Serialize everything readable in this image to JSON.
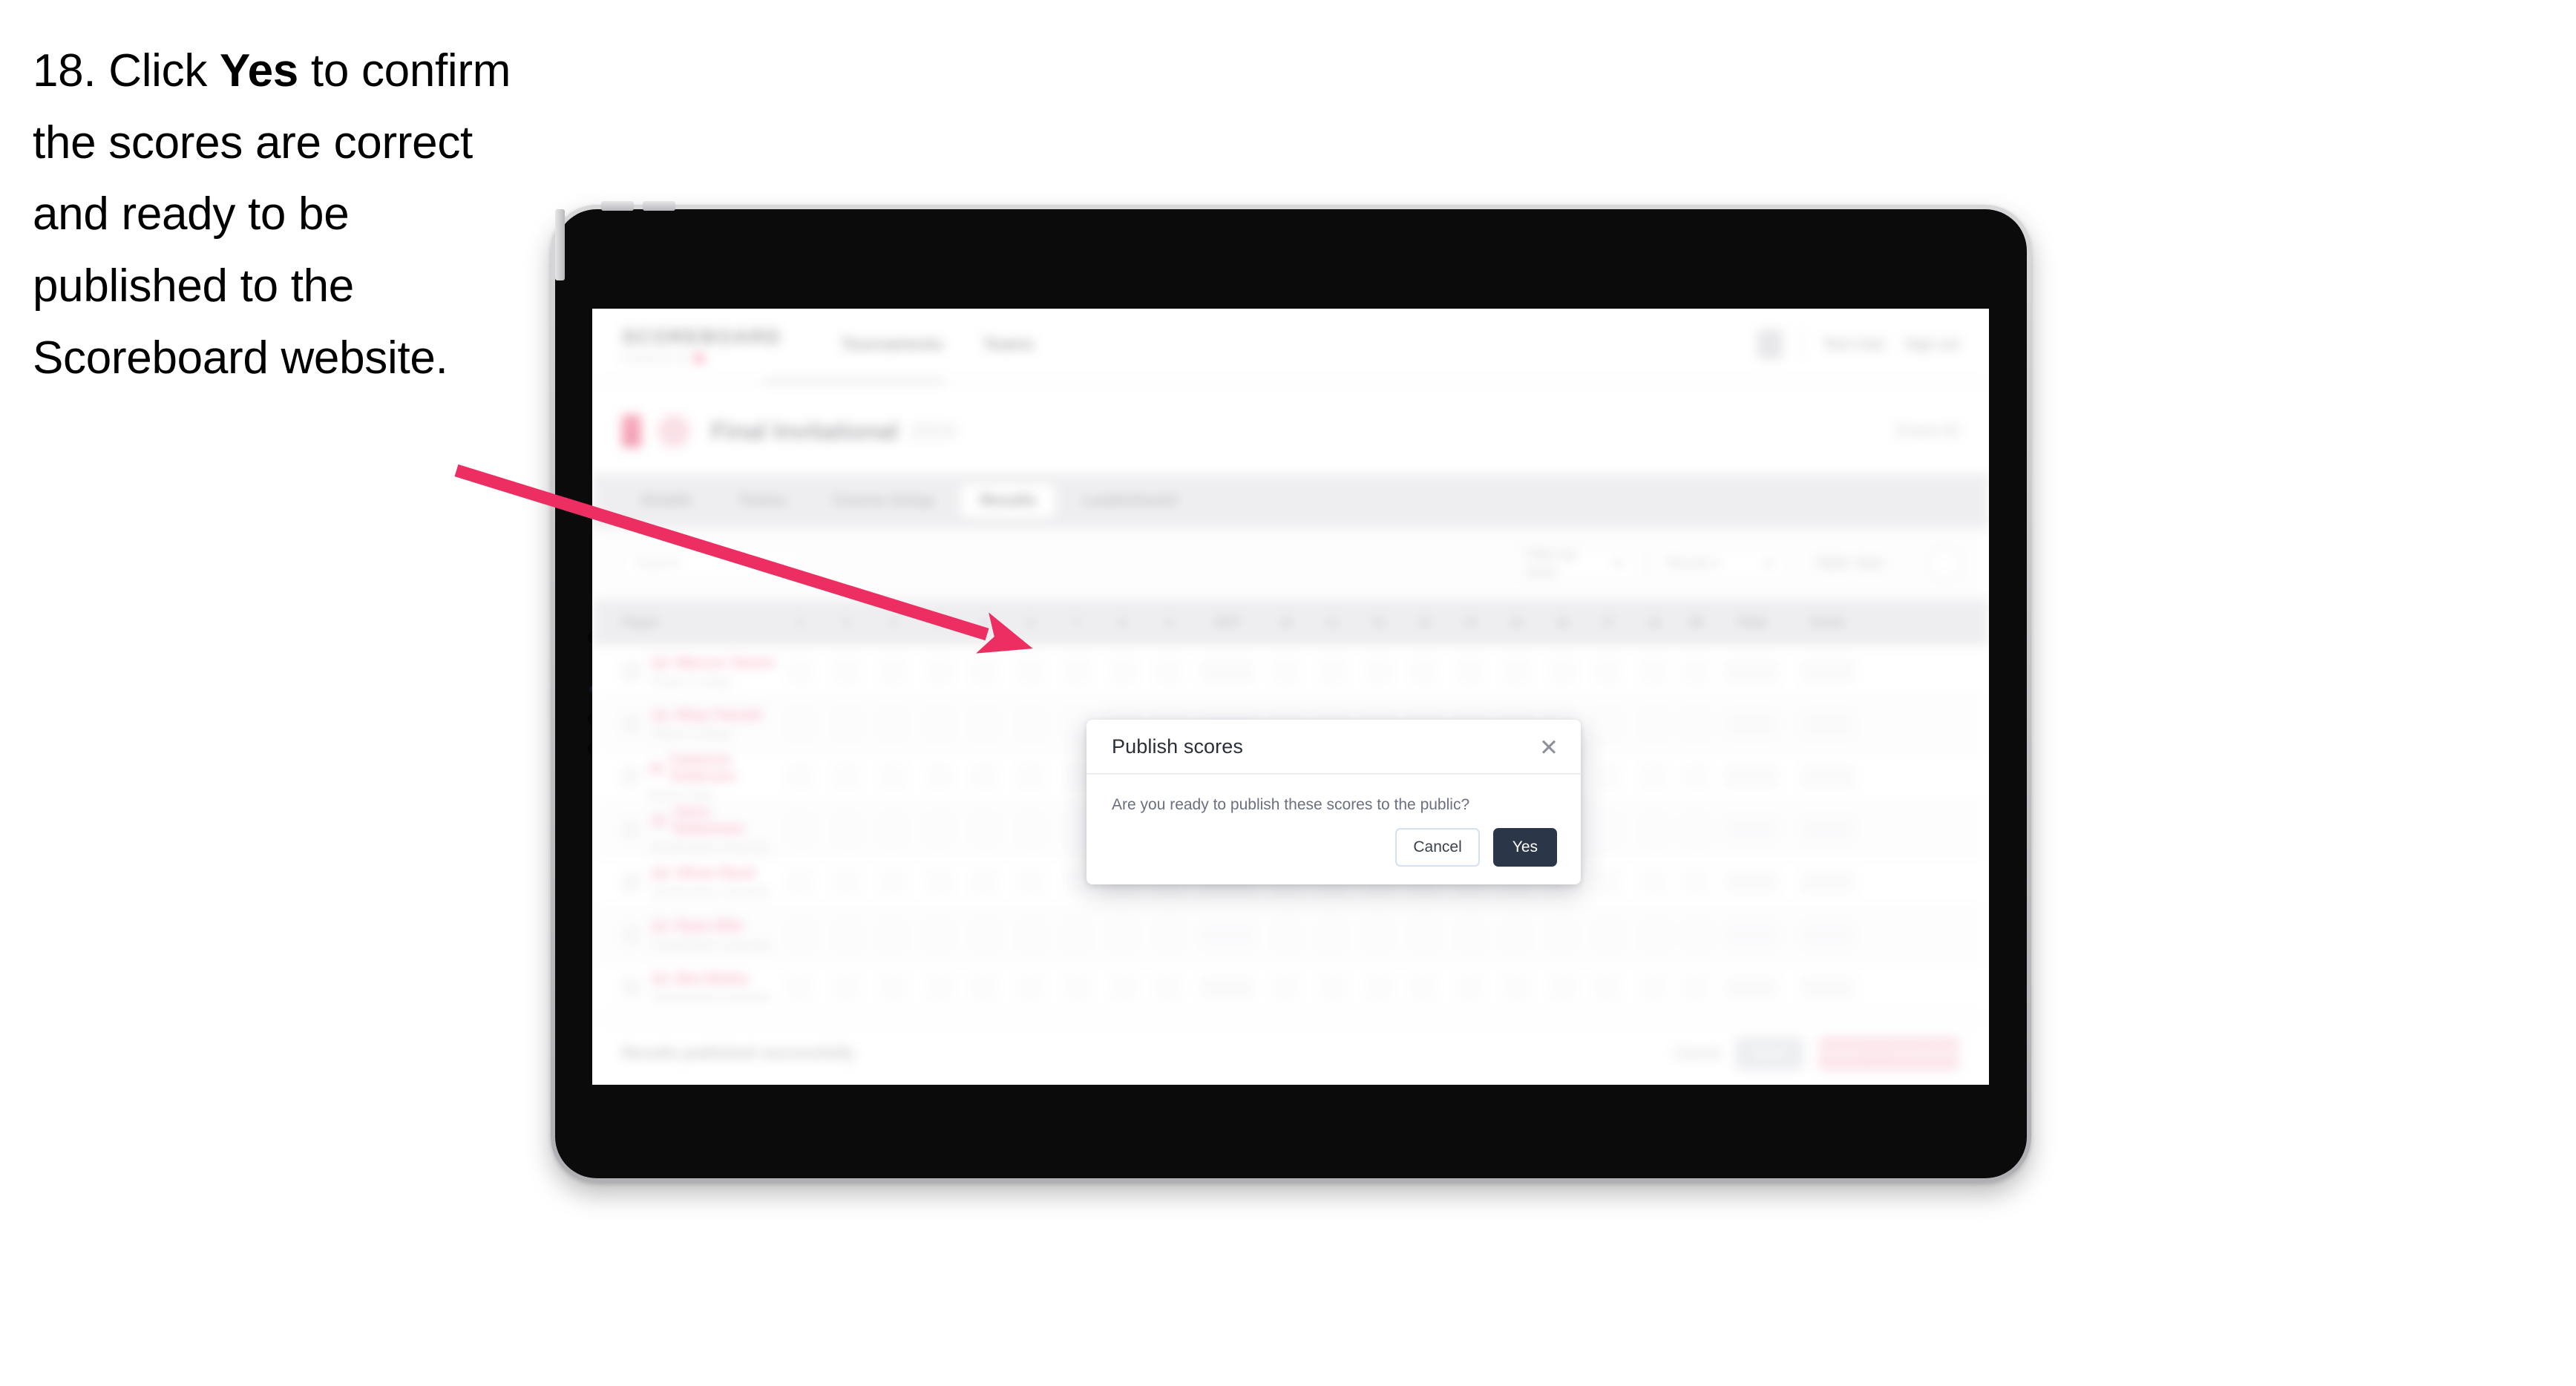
{
  "instruction": {
    "number": "18.",
    "part1": " Click ",
    "emphasis": "Yes",
    "part2": " to confirm the scores are correct and ready to be published to the Scoreboard website."
  },
  "colors": {
    "arrow": "#EC2E62",
    "accent_pink": "#F2355F",
    "yes_button": "#2B3649",
    "device_bezel": "#0B0B0B",
    "device_rim": "#C6C6C9"
  },
  "dialog": {
    "title": "Publish scores",
    "message": "Are you ready to publish these scores to the public?",
    "close_icon": "close-icon",
    "cancel_label": "Cancel",
    "yes_label": "Yes"
  },
  "app": {
    "brand": "SCOREBOARD",
    "brand_sub": "POWERED BY",
    "nav": [
      {
        "label": "Tournaments"
      },
      {
        "label": "Teams"
      }
    ],
    "header_right": [
      {
        "label": "Test User"
      },
      {
        "label": "Sign out"
      }
    ],
    "event": {
      "title": "Final Invitational",
      "subtitle": "2024",
      "right_label": "Event ID"
    },
    "tabs": [
      {
        "label": "Details",
        "active": false
      },
      {
        "label": "Teams",
        "active": false
      },
      {
        "label": "Course Setup",
        "active": false
      },
      {
        "label": "Results",
        "active": true
      },
      {
        "label": "Leaderboard",
        "active": false
      }
    ],
    "filters": {
      "search_placeholder": "Search",
      "control_1": "Filter by team",
      "control_2": "Round 1",
      "control_3": "Table View",
      "settings_icon": "settings-icon"
    },
    "table": {
      "columns_player": "Player",
      "holes": [
        "1",
        "2",
        "3",
        "4",
        "5",
        "6",
        "7",
        "8",
        "9",
        "10",
        "11",
        "12",
        "13",
        "14",
        "15",
        "16",
        "17",
        "18"
      ],
      "par_label": "Par",
      "column_out": "OUT",
      "column_in": "IN",
      "column_total": "Total",
      "column_score": "Score",
      "rows": [
        {
          "name": "Marcus Tanner",
          "club": "Player's College",
          "flag": "flag-icon"
        },
        {
          "name": "Rhys Parnell",
          "club": "Player's College",
          "flag": "flag-icon"
        },
        {
          "name": "Cameron Anderson",
          "club": "Boston Team",
          "flag": "flag-icon"
        },
        {
          "name": "Chris Robertson",
          "club": "Southampton University",
          "flag": "flag-icon"
        },
        {
          "name": "Oliver Reed",
          "club": "Southampton University",
          "flag": "flag-icon"
        },
        {
          "name": "Ryan Ellis",
          "club": "Southampton University",
          "flag": "flag-icon"
        },
        {
          "name": "Ben Bailey",
          "club": "Southampton University",
          "flag": "flag-icon"
        }
      ]
    },
    "action_bar": {
      "note": "Results published successfully",
      "ghost_label": "Cancel",
      "gray_label": "Save",
      "pink_label": "Publish to Scoreboard"
    }
  },
  "device": {
    "type": "tablet",
    "volume_button": "volume-button",
    "camera": "camera-icon"
  }
}
